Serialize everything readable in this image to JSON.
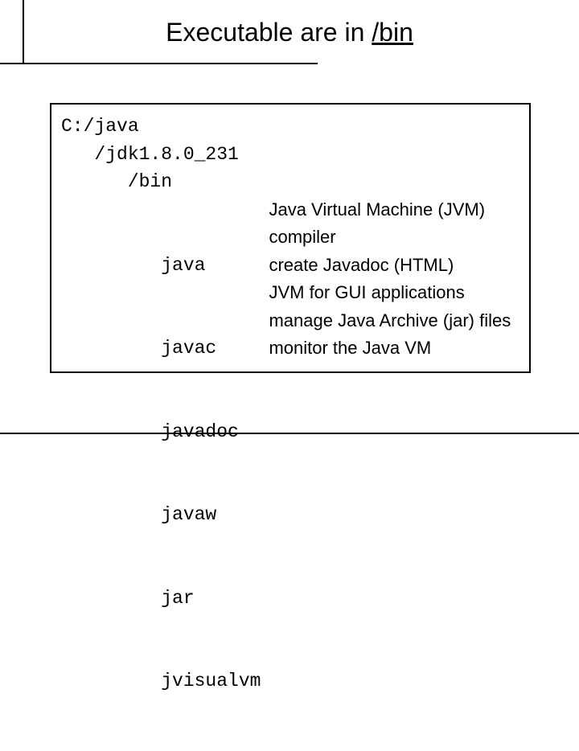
{
  "title": {
    "prefix": "Executable are in ",
    "path": "/bin"
  },
  "paths": {
    "root": "C:/java",
    "jdk": "   /jdk1.8.0_231",
    "bin": "      /bin"
  },
  "executables": [
    {
      "name": "         java",
      "desc": "Java Virtual Machine (JVM)"
    },
    {
      "name": "         javac",
      "desc": "compiler"
    },
    {
      "name": "         javadoc",
      "desc": "create Javadoc (HTML)"
    },
    {
      "name": "         javaw",
      "desc": "JVM for GUI applications"
    },
    {
      "name": "         jar",
      "desc": "manage Java Archive (jar) files"
    },
    {
      "name": "         jvisualvm",
      "desc": "monitor the Java VM"
    }
  ]
}
